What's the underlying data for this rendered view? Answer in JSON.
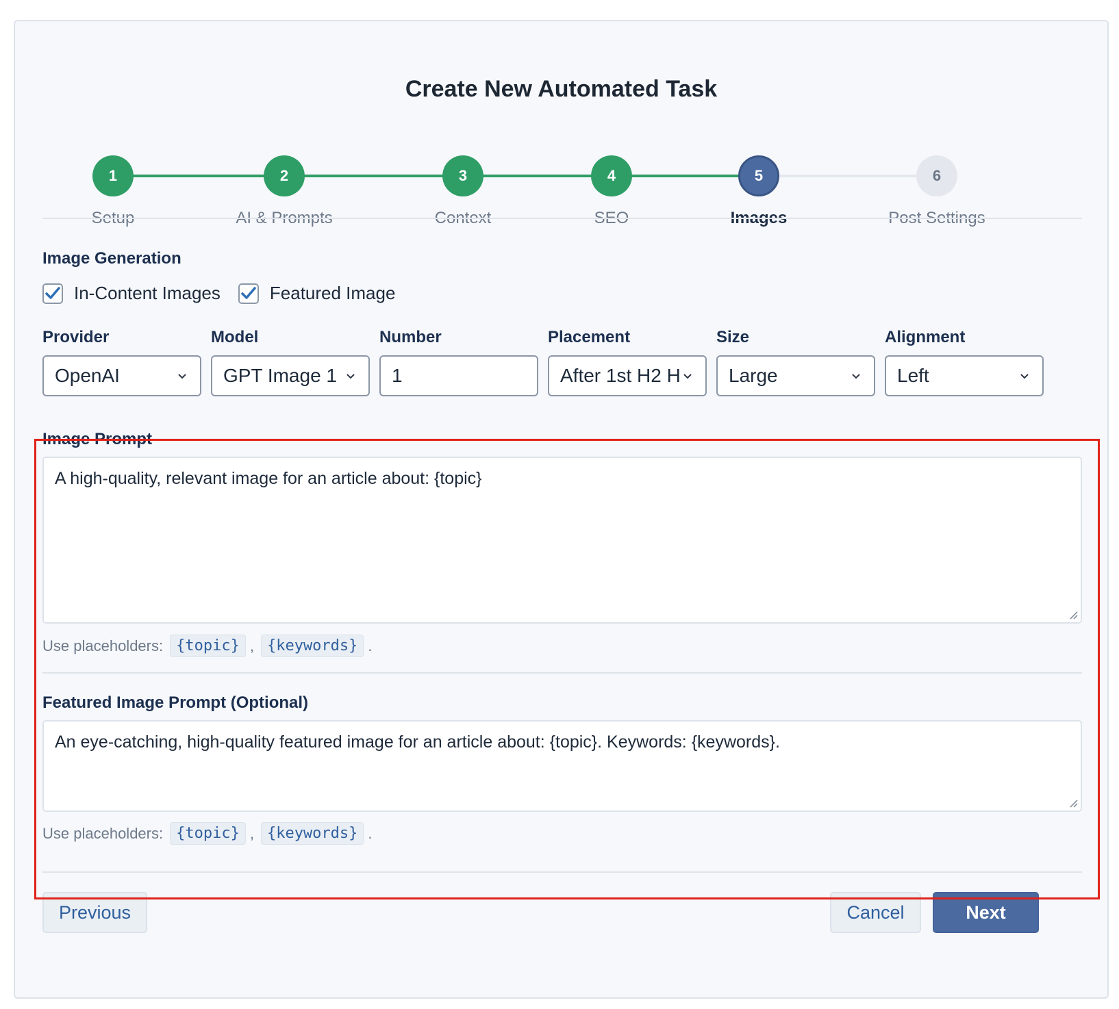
{
  "title": "Create New Automated Task",
  "steps": [
    {
      "number": "1",
      "label": "Setup",
      "state": "done"
    },
    {
      "number": "2",
      "label": "AI & Prompts",
      "state": "done"
    },
    {
      "number": "3",
      "label": "Context",
      "state": "done"
    },
    {
      "number": "4",
      "label": "SEO",
      "state": "done"
    },
    {
      "number": "5",
      "label": "Images",
      "state": "active"
    },
    {
      "number": "6",
      "label": "Post Settings",
      "state": "todo"
    }
  ],
  "image_generation": {
    "heading": "Image Generation",
    "in_content_label": "In-Content Images",
    "in_content_checked": true,
    "featured_label": "Featured Image",
    "featured_checked": true
  },
  "fields": {
    "provider": {
      "label": "Provider",
      "value": "OpenAI"
    },
    "model": {
      "label": "Model",
      "value": "GPT Image 1"
    },
    "number": {
      "label": "Number",
      "value": "1"
    },
    "placement": {
      "label": "Placement",
      "value": "After 1st H2 H"
    },
    "size": {
      "label": "Size",
      "value": "Large"
    },
    "alignment": {
      "label": "Alignment",
      "value": "Left"
    }
  },
  "image_prompt": {
    "label": "Image Prompt",
    "value": "A high-quality, relevant image for an article about: {topic}",
    "hint_prefix": "Use placeholders:",
    "placeholder_1": "{topic}",
    "separator": ",",
    "placeholder_2": "{keywords}",
    "hint_suffix": "."
  },
  "featured_prompt": {
    "label": "Featured Image Prompt (Optional)",
    "value": "An eye-catching, high-quality featured image for an article about: {topic}. Keywords: {keywords}.",
    "hint_prefix": "Use placeholders:",
    "placeholder_1": "{topic}",
    "separator": ",",
    "placeholder_2": "{keywords}",
    "hint_suffix": "."
  },
  "buttons": {
    "previous": "Previous",
    "cancel": "Cancel",
    "next": "Next"
  },
  "colors": {
    "done": "#2e9e66",
    "active": "#4a6aa0",
    "highlight": "#e0231a"
  }
}
